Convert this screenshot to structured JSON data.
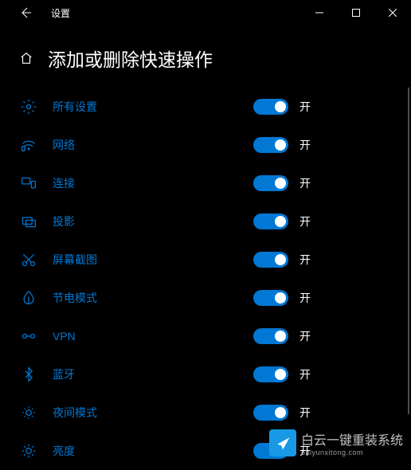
{
  "window": {
    "title": "设置"
  },
  "page": {
    "title": "添加或删除快速操作"
  },
  "toggle_state_label": "开",
  "items": [
    {
      "key": "all-settings",
      "label": "所有设置",
      "icon": "gear"
    },
    {
      "key": "network",
      "label": "网络",
      "icon": "wifi"
    },
    {
      "key": "connect",
      "label": "连接",
      "icon": "connect"
    },
    {
      "key": "project",
      "label": "投影",
      "icon": "project"
    },
    {
      "key": "screenshot",
      "label": "屏幕截图",
      "icon": "snip"
    },
    {
      "key": "battery-saver",
      "label": "节电模式",
      "icon": "leaf"
    },
    {
      "key": "vpn",
      "label": "VPN",
      "icon": "vpn"
    },
    {
      "key": "bluetooth",
      "label": "蓝牙",
      "icon": "bluetooth"
    },
    {
      "key": "night-light",
      "label": "夜间模式",
      "icon": "night"
    },
    {
      "key": "brightness",
      "label": "亮度",
      "icon": "brightness"
    }
  ],
  "watermark": {
    "text": "白云一键重装系统",
    "sub": "baiyunxitong.com"
  }
}
